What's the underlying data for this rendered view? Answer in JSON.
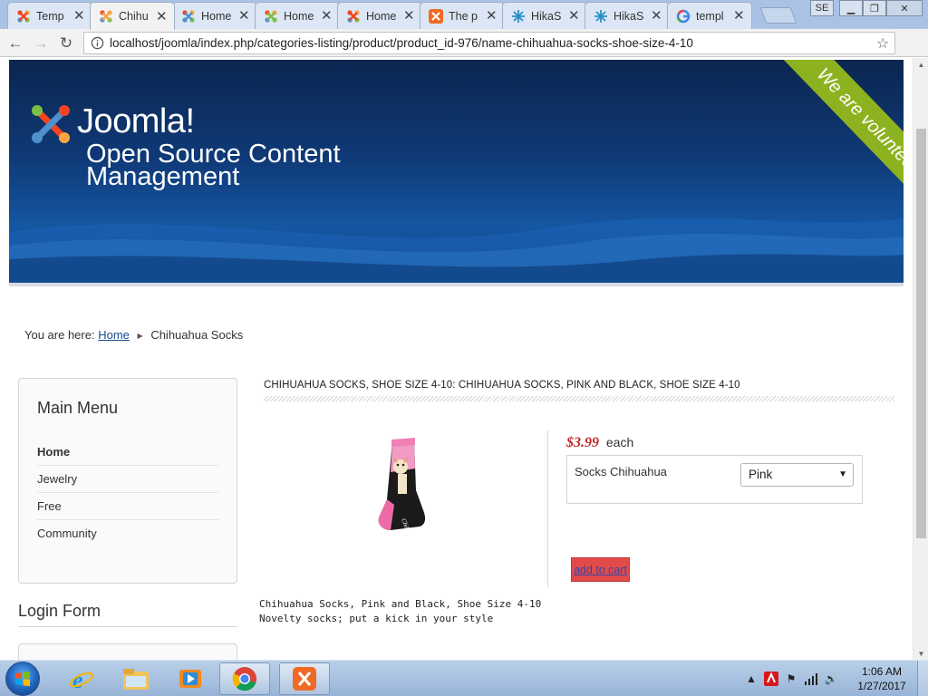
{
  "browser": {
    "tabs": [
      {
        "title": "Temp",
        "icon": "joomla-icon",
        "active": false
      },
      {
        "title": "Chihu",
        "icon": "joomla-icon",
        "active": true
      },
      {
        "title": "Home",
        "icon": "joomla-icon",
        "active": false
      },
      {
        "title": "Home",
        "icon": "joomla-icon",
        "active": false
      },
      {
        "title": "Home",
        "icon": "joomla-icon",
        "active": false
      },
      {
        "title": "The p",
        "icon": "xampp-icon",
        "active": false
      },
      {
        "title": "HikaS",
        "icon": "hikashop-icon",
        "active": false
      },
      {
        "title": "HikaS",
        "icon": "hikashop-icon",
        "active": false
      },
      {
        "title": "templ",
        "icon": "google-icon",
        "active": false
      }
    ],
    "profile_label": "SE",
    "url": "localhost/joomla/index.php/categories-listing/product/product_id-976/name-chihuahua-socks-shoe-size-4-10"
  },
  "banner": {
    "brand": "Joomla!",
    "tagline": "Open Source Content Management",
    "ribbon": "We are volunteers !"
  },
  "breadcrumb": {
    "prefix": "You are here:",
    "home": "Home",
    "current": "Chihuahua Socks"
  },
  "sidebar": {
    "menu_title": "Main Menu",
    "menu_items": [
      {
        "label": "Home",
        "current": true
      },
      {
        "label": "Jewelry",
        "current": false
      },
      {
        "label": "Free",
        "current": false
      },
      {
        "label": "Community",
        "current": false
      }
    ],
    "login_title": "Login Form"
  },
  "product": {
    "heading": "CHIHUAHUA SOCKS, SHOE SIZE 4-10: CHIHUAHUA SOCKS, PINK AND BLACK, SHOE SIZE 4-10",
    "price": "$3.99",
    "price_unit": "each",
    "option_label": "Socks Chihuahua",
    "option_selected": "Pink",
    "add_to_cart": "add to cart",
    "description_line1": "Chihuahua Socks, Pink and Black, Shoe Size 4-10",
    "description_line2": "Novelty socks; put a kick in your style",
    "price_color": "#c0282d",
    "cart_button_color": "#e34a4a"
  },
  "taskbar": {
    "apps": [
      "internet-explorer-icon",
      "file-explorer-icon",
      "media-player-icon",
      "chrome-icon",
      "xampp-icon"
    ],
    "time": "1:06 AM",
    "date": "1/27/2017"
  }
}
